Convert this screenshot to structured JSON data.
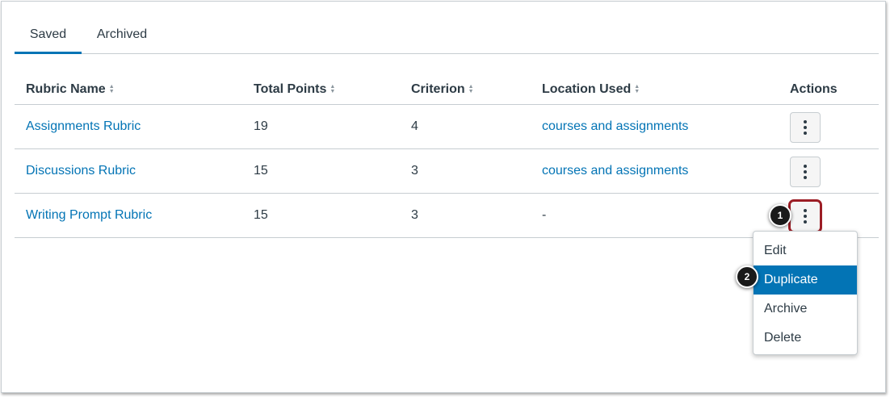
{
  "tabs": [
    {
      "label": "Saved",
      "selected": true
    },
    {
      "label": "Archived",
      "selected": false
    }
  ],
  "table": {
    "columns": [
      {
        "label": "Rubric Name",
        "sortable": true
      },
      {
        "label": "Total Points",
        "sortable": true
      },
      {
        "label": "Criterion",
        "sortable": true
      },
      {
        "label": "Location Used",
        "sortable": true
      },
      {
        "label": "Actions",
        "sortable": false
      }
    ],
    "rows": [
      {
        "name": "Assignments Rubric",
        "points": "19",
        "criterion": "4",
        "location": "courses and assignments"
      },
      {
        "name": "Discussions Rubric",
        "points": "15",
        "criterion": "3",
        "location": "courses and assignments"
      },
      {
        "name": "Writing Prompt Rubric",
        "points": "15",
        "criterion": "3",
        "location": "-"
      }
    ]
  },
  "callouts": {
    "one": "1",
    "two": "2"
  },
  "menu": {
    "items": [
      {
        "label": "Edit"
      },
      {
        "label": "Duplicate",
        "highlighted": true
      },
      {
        "label": "Archive"
      },
      {
        "label": "Delete"
      }
    ]
  },
  "colors": {
    "accent": "#0374b5",
    "focus_ring": "#9c1d25",
    "text": "#2d3b45",
    "border": "#c7cdd1"
  },
  "icons": {
    "sort": "sort-arrows-icon",
    "actions": "kebab-menu-icon"
  }
}
